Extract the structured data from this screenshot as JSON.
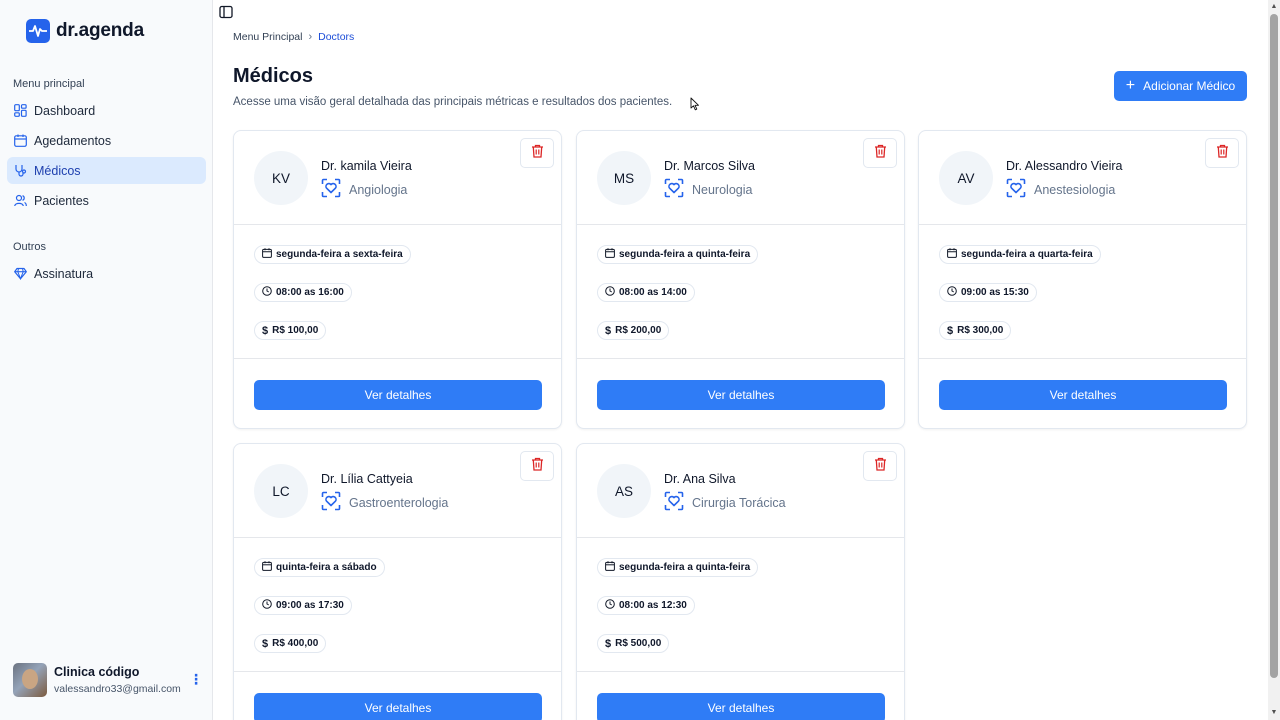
{
  "app": {
    "name": "dr.agenda"
  },
  "sidebar": {
    "group_main": "Menu principal",
    "items": [
      {
        "label": "Dashboard",
        "icon": "dashboard-icon"
      },
      {
        "label": "Agedamentos",
        "icon": "calendar-icon"
      },
      {
        "label": "Médicos",
        "icon": "stethoscope-icon",
        "active": true
      },
      {
        "label": "Pacientes",
        "icon": "users-icon"
      }
    ],
    "group_other": "Outros",
    "other_items": [
      {
        "label": "Assinatura",
        "icon": "gem-icon"
      }
    ],
    "user": {
      "name": "Clinica código",
      "email": "valessandro33@gmail.com"
    }
  },
  "breadcrumb": {
    "root": "Menu Principal",
    "current": "Doctors"
  },
  "header": {
    "title": "Médicos",
    "subtitle": "Acesse uma visão geral detalhada das principais métricas e resultados dos pacientes.",
    "add_button": "Adicionar Médico"
  },
  "doctors": [
    {
      "initials": "KV",
      "name": "Dr. kamila Vieira",
      "specialty": "Angiologia",
      "days": "segunda-feira a sexta-feira",
      "hours": "08:00 as 16:00",
      "price": "R$ 100,00",
      "button": "Ver detalhes"
    },
    {
      "initials": "MS",
      "name": "Dr. Marcos Silva",
      "specialty": "Neurologia",
      "days": "segunda-feira a quinta-feira",
      "hours": "08:00 as 14:00",
      "price": "R$ 200,00",
      "button": "Ver detalhes"
    },
    {
      "initials": "AV",
      "name": "Dr. Alessandro Vieira",
      "specialty": "Anestesiologia",
      "days": "segunda-feira a quarta-feira",
      "hours": "09:00 as 15:30",
      "price": "R$ 300,00",
      "button": "Ver detalhes"
    },
    {
      "initials": "LC",
      "name": "Dr. Lília Cattyeia",
      "specialty": "Gastroenterologia",
      "days": "quinta-feira a sábado",
      "hours": "09:00 as 17:30",
      "price": "R$ 400,00",
      "button": "Ver detalhes"
    },
    {
      "initials": "AS",
      "name": "Dr. Ana Silva",
      "specialty": "Cirurgia Torácica",
      "days": "segunda-feira a quinta-feira",
      "hours": "08:00 as 12:30",
      "price": "R$ 500,00",
      "button": "Ver detalhes"
    }
  ],
  "colors": {
    "primary": "#2f7cf6",
    "danger": "#dc2626",
    "active_bg": "#dbeafe"
  }
}
